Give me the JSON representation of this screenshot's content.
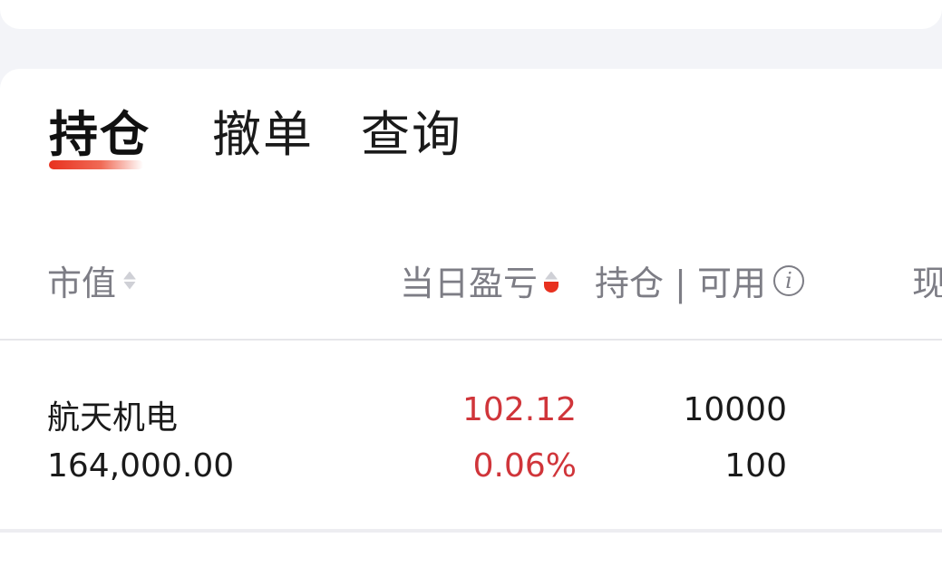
{
  "tabs": [
    {
      "label": "持仓",
      "active": true
    },
    {
      "label": "撤单",
      "active": false
    },
    {
      "label": "查询",
      "active": false
    }
  ],
  "table": {
    "headers": {
      "market_value": "市值",
      "daily_pl": "当日盈亏",
      "position": "持仓 | 可用",
      "current_price": "现"
    },
    "rows": [
      {
        "name": "航天机电",
        "market_value": "164,000.00",
        "daily_pl": "102.12",
        "daily_pl_pct": "0.06%",
        "position": "10000",
        "available": "100"
      }
    ]
  },
  "colors": {
    "accent": "#e8311f",
    "profit": "#d0353a",
    "header_text": "#7d7d85"
  },
  "icons": [
    "sort-icon",
    "sort-desc-icon",
    "info-icon"
  ]
}
